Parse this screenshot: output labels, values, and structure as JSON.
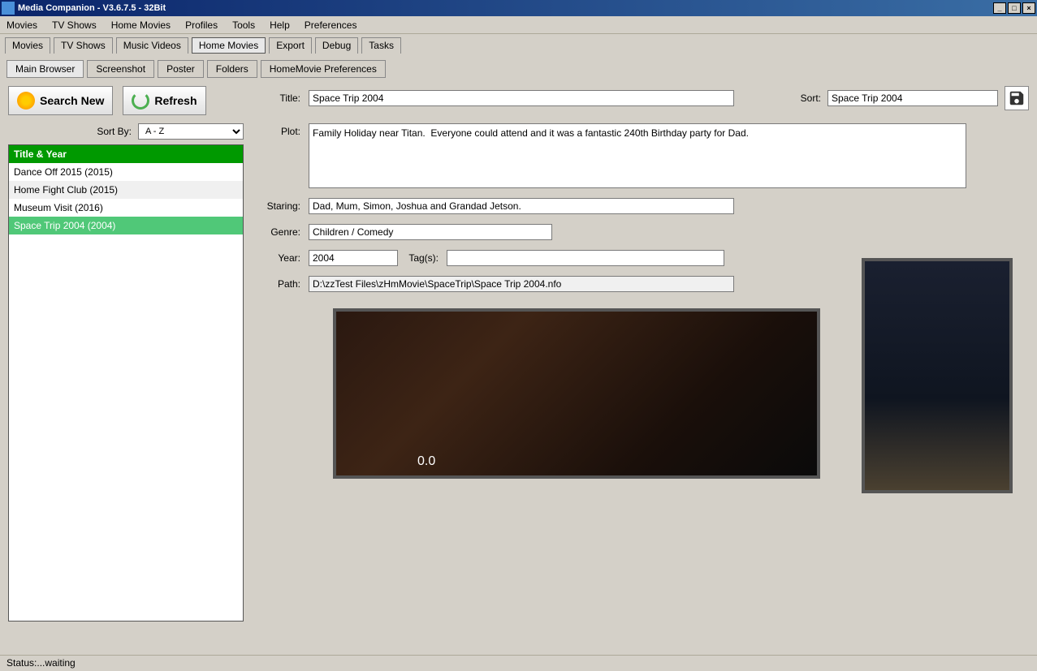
{
  "window": {
    "title": "Media Companion - V3.6.7.5 - 32Bit"
  },
  "menubar": [
    "Movies",
    "TV Shows",
    "Home Movies",
    "Profiles",
    "Tools",
    "Help",
    "Preferences"
  ],
  "main_tabs": [
    "Movies",
    "TV Shows",
    "Music Videos",
    "Home Movies",
    "Export",
    "Debug",
    "Tasks"
  ],
  "main_tab_active": "Home Movies",
  "sub_tabs": [
    "Main Browser",
    "Screenshot",
    "Poster",
    "Folders",
    "HomeMovie Preferences"
  ],
  "sub_tab_active": "Main Browser",
  "buttons": {
    "search_new": "Search New",
    "refresh": "Refresh"
  },
  "sort": {
    "label": "Sort By:",
    "value": "A - Z"
  },
  "list": {
    "header": "Title & Year",
    "items": [
      {
        "label": "Dance Off 2015 (2015)",
        "selected": false
      },
      {
        "label": "Home Fight Club (2015)",
        "selected": false
      },
      {
        "label": "Museum Visit (2016)",
        "selected": false
      },
      {
        "label": "Space Trip 2004 (2004)",
        "selected": true
      }
    ]
  },
  "fields": {
    "title_label": "Title:",
    "title": "Space Trip 2004",
    "sort_label": "Sort:",
    "sort_value": "Space Trip 2004",
    "plot_label": "Plot:",
    "plot": "Family Holiday near Titan.  Everyone could attend and it was a fantastic 240th Birthday party for Dad.",
    "staring_label": "Staring:",
    "staring": "Dad, Mum, Simon, Joshua and Grandad Jetson.",
    "genre_label": "Genre:",
    "genre": "Children / Comedy",
    "year_label": "Year:",
    "year": "2004",
    "tags_label": "Tag(s):",
    "tags": "",
    "path_label": "Path:",
    "path": "D:\\zzTest Files\\zHmMovie\\SpaceTrip\\Space Trip 2004.nfo"
  },
  "backdrop_overlay": "0.0",
  "status": "Status:...waiting"
}
